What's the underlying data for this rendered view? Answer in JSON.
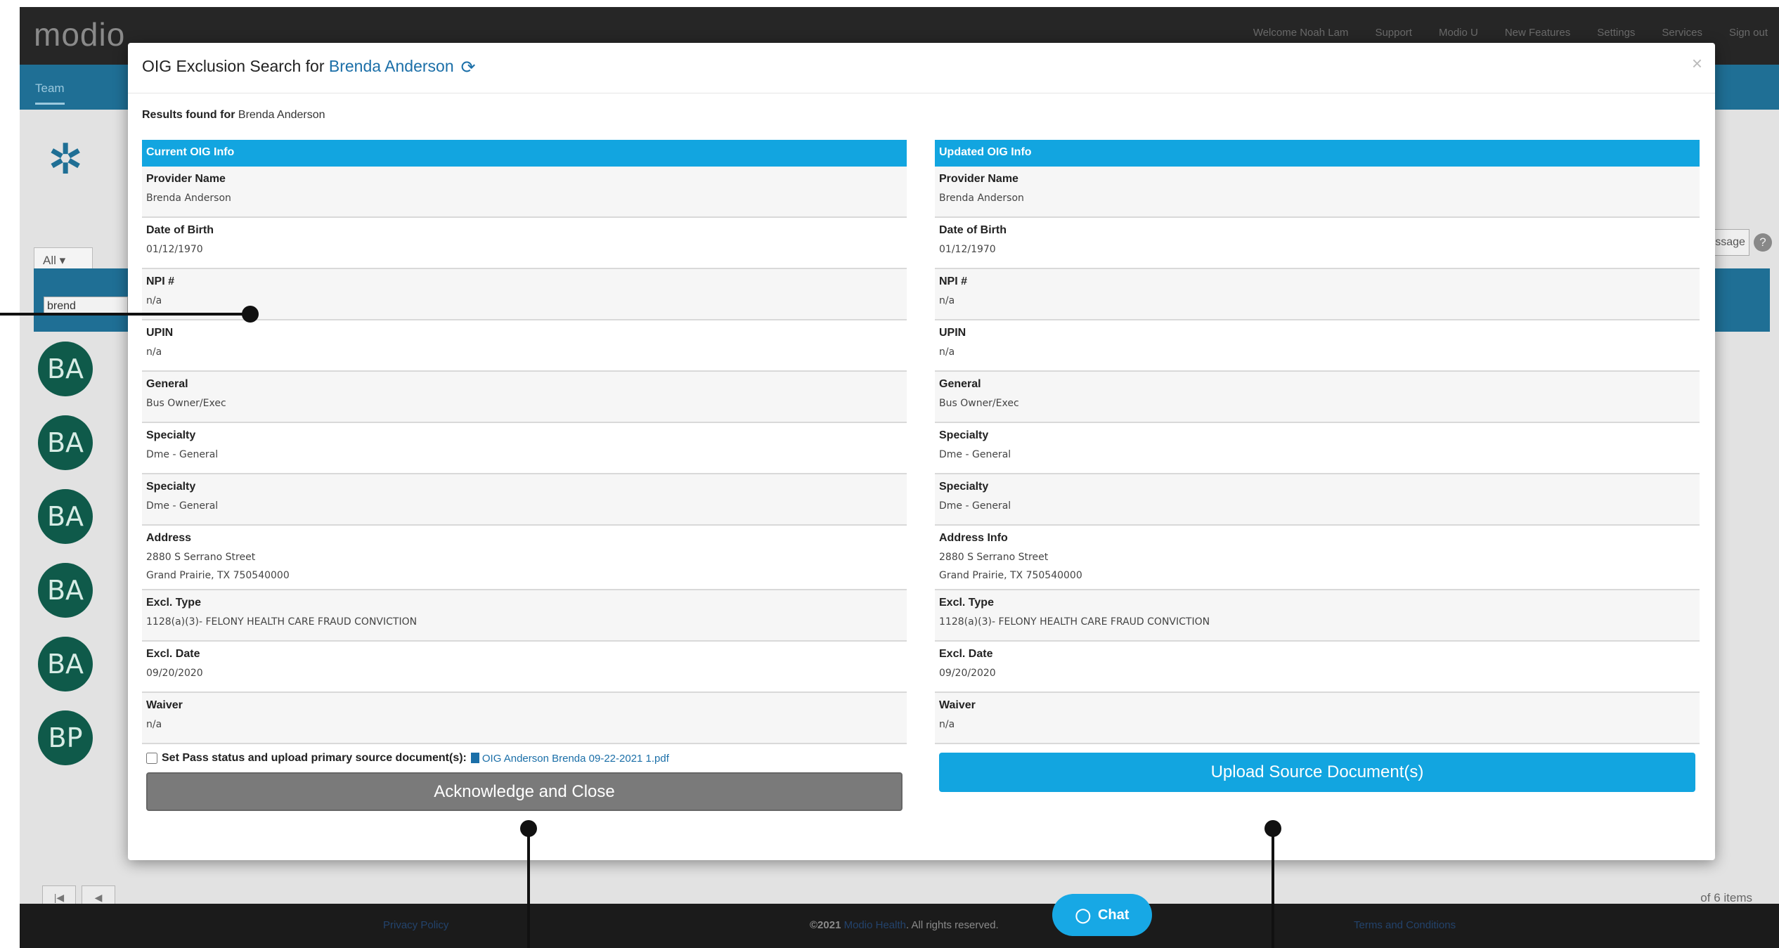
{
  "app": {
    "logo": "modio",
    "nav": [
      "Welcome Noah Lam",
      "Support",
      "Modio U",
      "New Features",
      "Settings",
      "Services",
      "Sign out"
    ],
    "tab": "Team",
    "filter_select": "All",
    "filter_text": "brend",
    "message_btn": "Message",
    "help": "?",
    "avatars": [
      "BA",
      "BA",
      "BA",
      "BA",
      "BA",
      "BP"
    ],
    "items_text": "of 6 items",
    "pager": [
      "|◀",
      "◀"
    ]
  },
  "footer": {
    "privacy": "Privacy Policy",
    "copyright_prefix": "©2021 ",
    "company": "Modio Health",
    "copyright_suffix": ". All rights reserved.",
    "terms": "Terms and Conditions"
  },
  "chat": {
    "label": "Chat"
  },
  "modal": {
    "title_prefix": "OIG Exclusion Search for ",
    "title_name": "Brenda Anderson",
    "close": "×",
    "results_label": "Results found for",
    "results_name": "Brenda Anderson",
    "current": {
      "header": "Current OIG Info",
      "fields": [
        {
          "label": "Provider Name",
          "value": "Brenda Anderson"
        },
        {
          "label": "Date of Birth",
          "value": "01/12/1970"
        },
        {
          "label": "NPI #",
          "value": "n/a"
        },
        {
          "label": "UPIN",
          "value": "n/a"
        },
        {
          "label": "General",
          "value": "Bus Owner/Exec"
        },
        {
          "label": "Specialty",
          "value": "Dme - General"
        },
        {
          "label": "Specialty",
          "value": "Dme - General"
        },
        {
          "label": "Address",
          "value": "2880 S Serrano Street\nGrand Prairie, TX 750540000"
        },
        {
          "label": "Excl. Type",
          "value": "1128(a)(3)- FELONY HEALTH CARE FRAUD CONVICTION"
        },
        {
          "label": "Excl. Date",
          "value": "09/20/2020"
        },
        {
          "label": "Waiver",
          "value": "n/a"
        }
      ],
      "pass_label": "Set Pass status and upload primary source document(s):",
      "pass_doc": "OIG Anderson Brenda 09-22-2021 1.pdf",
      "ack_button": "Acknowledge and Close"
    },
    "updated": {
      "header": "Updated OIG Info",
      "fields": [
        {
          "label": "Provider Name",
          "value": "Brenda Anderson"
        },
        {
          "label": "Date of Birth",
          "value": "01/12/1970"
        },
        {
          "label": "NPI #",
          "value": "n/a"
        },
        {
          "label": "UPIN",
          "value": "n/a"
        },
        {
          "label": "General",
          "value": "Bus Owner/Exec"
        },
        {
          "label": "Specialty",
          "value": "Dme - General"
        },
        {
          "label": "Specialty",
          "value": "Dme - General"
        },
        {
          "label": "Address Info",
          "value": "2880 S Serrano Street\nGrand Prairie, TX 750540000"
        },
        {
          "label": "Excl. Type",
          "value": "1128(a)(3)- FELONY HEALTH CARE FRAUD CONVICTION"
        },
        {
          "label": "Excl. Date",
          "value": "09/20/2020"
        },
        {
          "label": "Waiver",
          "value": "n/a"
        }
      ],
      "upload_button": "Upload Source Document(s)"
    }
  },
  "colors": {
    "accent": "#12a5e0",
    "link": "#1b6fa8",
    "ack": "#7a7a7a"
  }
}
